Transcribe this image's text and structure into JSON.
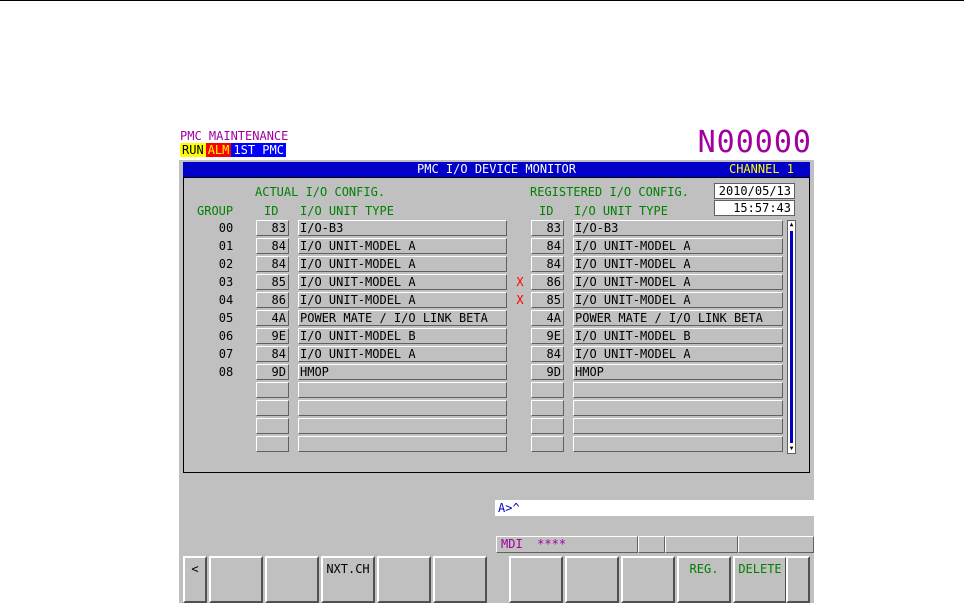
{
  "header": {
    "app_title": "PMC MAINTENANCE",
    "status": {
      "run": "RUN",
      "alm": "ALM",
      "pmc": "1ST PMC"
    },
    "program_no": "N00000"
  },
  "title_bar": {
    "title": "PMC I/O DEVICE MONITOR",
    "channel": "CHANNEL 1"
  },
  "panel": {
    "actual_heading": "ACTUAL I/O CONFIG.",
    "registered_heading": "REGISTERED I/O CONFIG.",
    "date": "2010/05/13",
    "time": "15:57:43",
    "columns": {
      "group": "GROUP",
      "id": "ID",
      "type": "I/O UNIT TYPE"
    },
    "rows": [
      {
        "group": "00",
        "actual_id": "83",
        "actual_type": "I/O-B3",
        "mark": "",
        "reg_id": "83",
        "reg_type": "I/O-B3"
      },
      {
        "group": "01",
        "actual_id": "84",
        "actual_type": "I/O UNIT-MODEL A",
        "mark": "",
        "reg_id": "84",
        "reg_type": "I/O UNIT-MODEL A"
      },
      {
        "group": "02",
        "actual_id": "84",
        "actual_type": "I/O UNIT-MODEL A",
        "mark": "",
        "reg_id": "84",
        "reg_type": "I/O UNIT-MODEL A"
      },
      {
        "group": "03",
        "actual_id": "85",
        "actual_type": "I/O UNIT-MODEL A",
        "mark": "X",
        "reg_id": "86",
        "reg_type": "I/O UNIT-MODEL A"
      },
      {
        "group": "04",
        "actual_id": "86",
        "actual_type": "I/O UNIT-MODEL A",
        "mark": "X",
        "reg_id": "85",
        "reg_type": "I/O UNIT-MODEL A"
      },
      {
        "group": "05",
        "actual_id": "4A",
        "actual_type": "POWER MATE / I/O LINK BETA",
        "mark": "",
        "reg_id": "4A",
        "reg_type": "POWER MATE / I/O LINK BETA"
      },
      {
        "group": "06",
        "actual_id": "9E",
        "actual_type": "I/O UNIT-MODEL B",
        "mark": "",
        "reg_id": "9E",
        "reg_type": "I/O UNIT-MODEL B"
      },
      {
        "group": "07",
        "actual_id": "84",
        "actual_type": "I/O UNIT-MODEL A",
        "mark": "",
        "reg_id": "84",
        "reg_type": "I/O UNIT-MODEL A"
      },
      {
        "group": "08",
        "actual_id": "9D",
        "actual_type": "HMOP",
        "mark": "",
        "reg_id": "9D",
        "reg_type": "HMOP"
      },
      {
        "group": "",
        "actual_id": "",
        "actual_type": "",
        "mark": "",
        "reg_id": "",
        "reg_type": ""
      },
      {
        "group": "",
        "actual_id": "",
        "actual_type": "",
        "mark": "",
        "reg_id": "",
        "reg_type": ""
      },
      {
        "group": "",
        "actual_id": "",
        "actual_type": "",
        "mark": "",
        "reg_id": "",
        "reg_type": ""
      },
      {
        "group": "",
        "actual_id": "",
        "actual_type": "",
        "mark": "",
        "reg_id": "",
        "reg_type": ""
      }
    ],
    "scroll_up": "▲",
    "scroll_down": "▼"
  },
  "input_line": "A>^",
  "mdi_status": {
    "mode": "MDI",
    "stars": "****"
  },
  "softkeys": {
    "return": "<",
    "keys": [
      "",
      "",
      "NXT.CH",
      "",
      "",
      "",
      "",
      "",
      "REG.",
      "DELETE"
    ],
    "continue": ""
  },
  "colors": {
    "header_magenta": "#a000a0",
    "title_blue": "#0000c8",
    "label_green": "#008000",
    "mismatch_red": "#ff0000"
  }
}
